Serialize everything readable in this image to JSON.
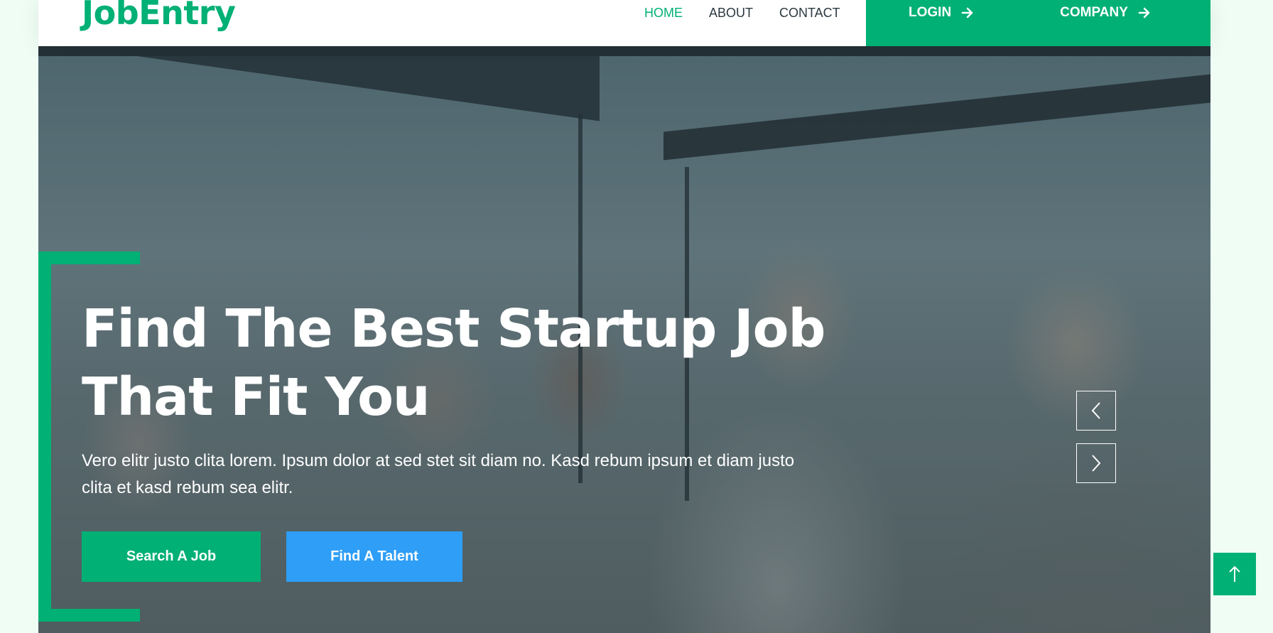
{
  "brand": "JobEntry",
  "nav": {
    "links": [
      {
        "label": "HOME"
      },
      {
        "label": "ABOUT"
      },
      {
        "label": "CONTACT"
      }
    ],
    "login_label": "LOGIN",
    "company_label": "COMPANY"
  },
  "hero": {
    "title_line1": "Find The Best Startup Job",
    "title_line2": "That Fit You",
    "text": "Vero elitr justo clita lorem. Ipsum dolor at sed stet sit diam no. Kasd rebum ipsum et diam justo clita et kasd rebum sea elitr.",
    "primary_button": "Search A Job",
    "secondary_button": "Find A Talent"
  },
  "colors": {
    "primary": "#00b074",
    "secondary": "#2e9ef7",
    "page_background": "#effdf5",
    "nav_text": "#2b3940"
  },
  "icons": {
    "login": "arrow-right-icon",
    "company": "arrow-right-icon",
    "carousel_prev": "chevron-left-icon",
    "carousel_next": "chevron-right-icon",
    "back_to_top": "arrow-up-icon"
  }
}
